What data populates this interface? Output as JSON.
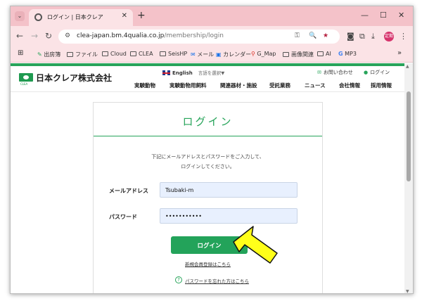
{
  "browser": {
    "tab_title": "ログイン | 日本クレア",
    "url_host": "clea-japan.bm.4qualia.co.jp",
    "url_path": "/membership/login",
    "profile_label": "定期"
  },
  "bookmarks": [
    {
      "icon": "pen-icon",
      "label": "出房簿"
    },
    {
      "icon": "folder-icon",
      "label": "ファイル"
    },
    {
      "icon": "folder-icon",
      "label": "Cloud"
    },
    {
      "icon": "folder-icon",
      "label": "CLEA"
    },
    {
      "icon": "folder-icon",
      "label": "SeisHP"
    },
    {
      "icon": "mail-icon",
      "label": "メール"
    },
    {
      "icon": "calendar-icon",
      "label": "カレンダー"
    },
    {
      "icon": "map-pin-icon",
      "label": "G_Map"
    },
    {
      "icon": "folder-icon",
      "label": "画像関連"
    },
    {
      "icon": "folder-icon",
      "label": "AI"
    },
    {
      "icon": "google-icon",
      "label": "MP3"
    }
  ],
  "site": {
    "logo_text": "日本クレア株式会社",
    "logo_sub": "CLEA",
    "language": "English",
    "language_select": "言語を選択▼",
    "contact": "お問い合わせ",
    "login_link": "ログイン",
    "nav": [
      "実験動物",
      "実験動物用飼料",
      "関連器材・施設",
      "受託業務",
      "ニュース",
      "会社情報",
      "採用情報"
    ]
  },
  "login": {
    "title": "ログイン",
    "instruction_line1": "下記にメールアドレスとパスワードをご入力して、",
    "instruction_line2": "ログインしてください。",
    "email_label": "メールアドレス",
    "email_value": "Tsubaki-m",
    "password_label": "パスワード",
    "password_value": "•••••••••••",
    "submit_label": "ログイン",
    "register_link": "新規会員登録はこちら",
    "forgot_link": "パスワードを忘れた方はこちら"
  },
  "colors": {
    "brand_green": "#27a45a",
    "arrow_yellow": "#ffff1a",
    "browser_pink": "#f4c2c9"
  }
}
